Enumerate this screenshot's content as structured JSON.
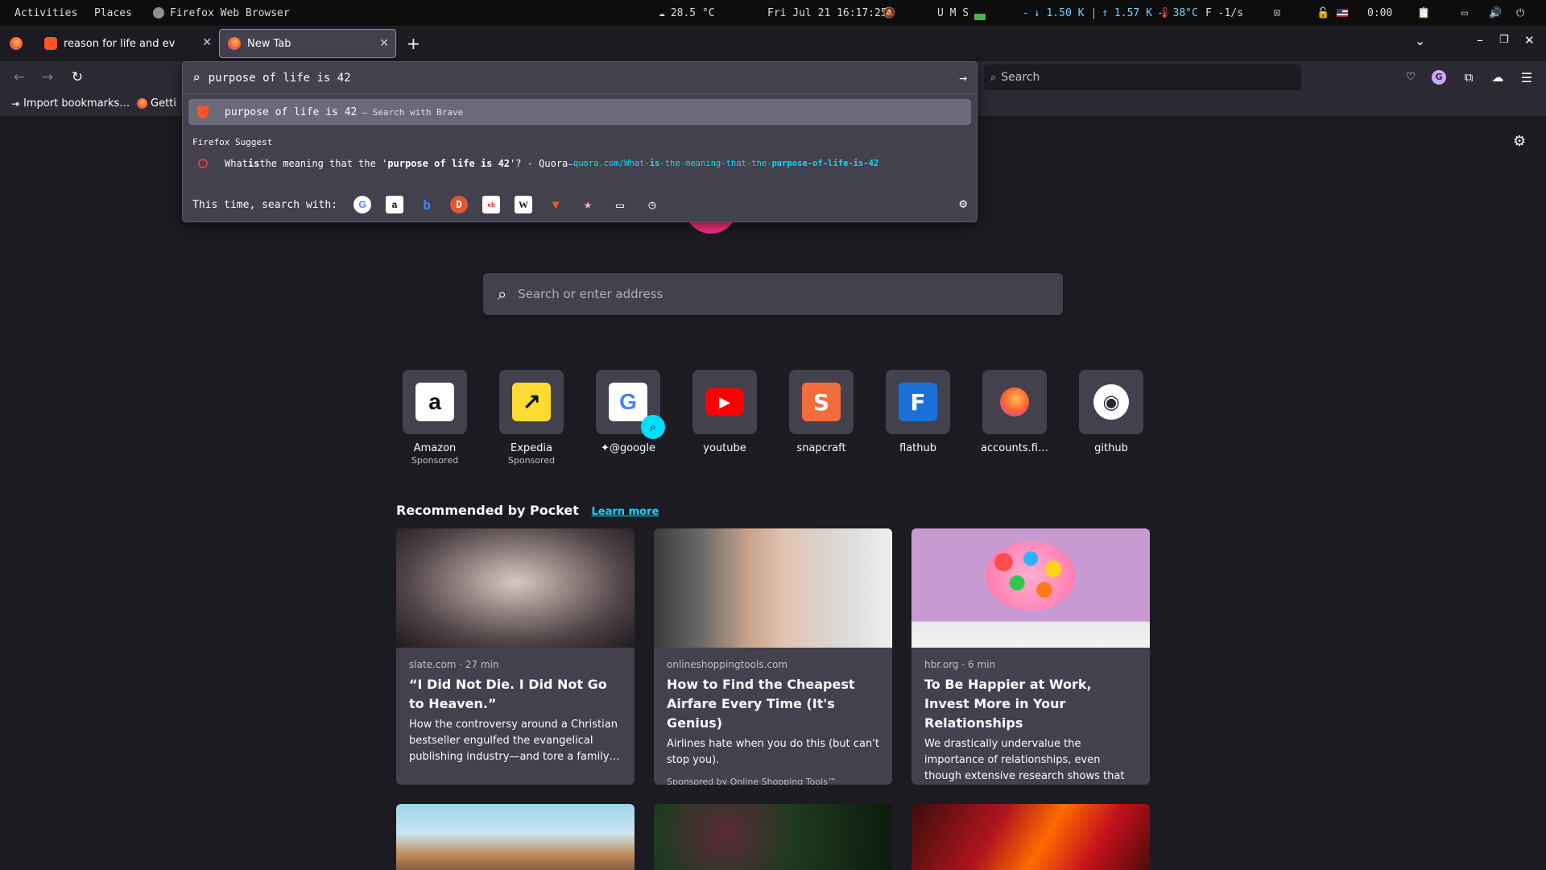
{
  "panel": {
    "activities": "Activities",
    "places": "Places",
    "app": "Firefox Web Browser",
    "weather": "28.5 °C",
    "clock": "Fri Jul 21 16:17:25",
    "sys": "U  M  S",
    "net_down": "↓ 1.50 K",
    "net_up": "↑ 1.57 K",
    "net_tail": "-",
    "temp": "38°C",
    "fan": "F -1/s",
    "time2": "0:00"
  },
  "tabs": [
    {
      "label": "reason for life and ev"
    },
    {
      "label": "New Tab"
    }
  ],
  "toolbar": {
    "search_placeholder": "Search"
  },
  "bookmarks": {
    "import": "Import bookmarks…",
    "getting": "Getti"
  },
  "urlbar": {
    "value": "purpose of life is 42",
    "row1_text": "purpose of life is 42",
    "row1_action": "— Search with Brave",
    "suggest_label": "Firefox Suggest",
    "row2_pre": "What ",
    "row2_is": "is",
    "row2_mid": " the meaning that the '",
    "row2_bold": "purpose of life is 42",
    "row2_post": "'? - Quora",
    "row2_sep": " — ",
    "row2_url_a": "quora.com/What-",
    "row2_url_b": "is",
    "row2_url_c": "-the-meaning-that-the-",
    "row2_url_d": "purpose-of-life-is-42",
    "oneoff_label": "This time, search with:",
    "engines": [
      "google",
      "amazon",
      "bing",
      "duckduckgo",
      "ebay",
      "wikipedia",
      "brave",
      "bookmarks",
      "tabs",
      "history"
    ]
  },
  "newtab": {
    "search_placeholder": "Search or enter address",
    "sites": [
      {
        "label": "Amazon",
        "sponsored": "Sponsored"
      },
      {
        "label": "Expedia",
        "sponsored": "Sponsored"
      },
      {
        "label": "@google"
      },
      {
        "label": "youtube"
      },
      {
        "label": "snapcraft"
      },
      {
        "label": "flathub"
      },
      {
        "label": "accounts.fi…"
      },
      {
        "label": "github"
      }
    ],
    "pocket_title": "Recommended by Pocket",
    "learn_more": "Learn more",
    "cards": [
      {
        "meta": "slate.com · 27 min",
        "title": "“I Did Not Die. I Did Not Go to Heaven.”",
        "excerpt": "How the controversy around a Christian bestseller engulfed the evangelical publishing industry—and tore a family…"
      },
      {
        "meta": "onlineshoppingtools.com",
        "title": "How to Find the Cheapest Airfare Every Time (It's Genius)",
        "excerpt": "Airlines hate when you do this (but can't stop you).",
        "sponsor": "Sponsored by Online Shopping Tools™"
      },
      {
        "meta": "hbr.org · 6 min",
        "title": "To Be Happier at Work, Invest More in Your Relationships",
        "excerpt": "We drastically undervalue the importance of relationships, even though extensive research shows that it’s peop…"
      }
    ]
  },
  "colors": {
    "accent": "#00ddff",
    "bg": "#1c1b22",
    "surface": "#42414d"
  }
}
